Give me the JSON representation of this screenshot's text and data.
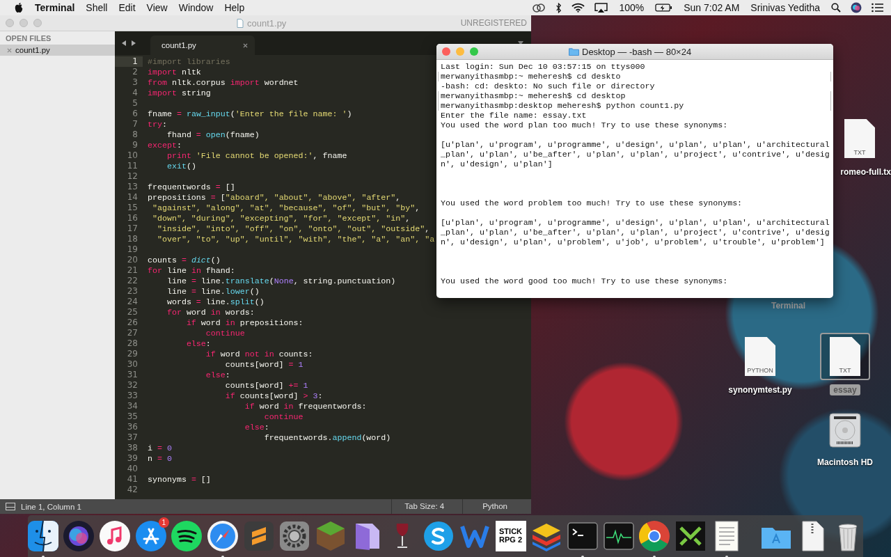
{
  "menu_bar": {
    "app": "Terminal",
    "items": [
      "Shell",
      "Edit",
      "View",
      "Window",
      "Help"
    ],
    "battery": "100%",
    "clock": "Sun 7:02 AM",
    "user": "Srinivas Yeditha"
  },
  "editor": {
    "title": "count1.py",
    "license": "UNREGISTERED",
    "sidebar": {
      "header": "OPEN FILES",
      "files": [
        {
          "name": "count1.py",
          "selected": true
        }
      ]
    },
    "tabs": [
      {
        "label": "count1.py",
        "selected": true
      }
    ],
    "lines": [
      {
        "n": "1",
        "current": true,
        "tokens": [
          {
            "kind": "cm",
            "text": "#import libraries"
          }
        ]
      },
      {
        "n": "2",
        "current": false,
        "tokens": [
          {
            "kind": "kw",
            "text": "import"
          },
          {
            "kind": "p",
            "text": " nltk"
          }
        ]
      },
      {
        "n": "3",
        "current": false,
        "tokens": [
          {
            "kind": "kw",
            "text": "from"
          },
          {
            "kind": "p",
            "text": " nltk.corpus"
          },
          {
            "kind": "kw",
            "text": " import"
          },
          {
            "kind": "p",
            "text": " wordnet"
          }
        ]
      },
      {
        "n": "4",
        "current": false,
        "tokens": [
          {
            "kind": "kw",
            "text": "import"
          },
          {
            "kind": "p",
            "text": " string"
          }
        ]
      },
      {
        "n": "5",
        "current": false
      },
      {
        "n": "6",
        "current": false,
        "tokens": [
          {
            "kind": "p",
            "text": "fname"
          },
          {
            "kind": "kw",
            "text": " ="
          },
          {
            "kind": "fn",
            "text": " raw_input"
          },
          {
            "kind": "p",
            "text": "("
          },
          {
            "kind": "str",
            "text": "'Enter the file name: '"
          },
          {
            "kind": "p",
            "text": ")"
          }
        ]
      },
      {
        "n": "7",
        "current": false,
        "tokens": [
          {
            "kind": "kw",
            "text": "try"
          },
          {
            "kind": "p",
            "text": ":"
          }
        ]
      },
      {
        "n": "8",
        "current": false,
        "tokens": [
          {
            "kind": "p",
            "text": "    fhand"
          },
          {
            "kind": "kw",
            "text": " ="
          },
          {
            "kind": "fn",
            "text": " open"
          },
          {
            "kind": "p",
            "text": "(fname)"
          }
        ]
      },
      {
        "n": "9",
        "current": false,
        "tokens": [
          {
            "kind": "kw",
            "text": "except"
          },
          {
            "kind": "p",
            "text": ":"
          }
        ]
      },
      {
        "n": "10",
        "current": false,
        "tokens": [
          {
            "kind": "kw",
            "text": "    print"
          },
          {
            "kind": "str",
            "text": " 'File cannot be opened:'"
          },
          {
            "kind": "p",
            "text": ", fname"
          }
        ]
      },
      {
        "n": "11",
        "current": false,
        "tokens": [
          {
            "kind": "fn",
            "text": "    exit"
          },
          {
            "kind": "p",
            "text": "()"
          }
        ]
      },
      {
        "n": "12",
        "current": false
      },
      {
        "n": "13",
        "current": false,
        "tokens": [
          {
            "kind": "p",
            "text": "frequentwords"
          },
          {
            "kind": "kw",
            "text": " ="
          },
          {
            "kind": "p",
            "text": " []"
          }
        ]
      },
      {
        "n": "14",
        "current": false,
        "tokens": [
          {
            "kind": "p",
            "text": "prepositions"
          },
          {
            "kind": "kw",
            "text": " ="
          },
          {
            "kind": "p",
            "text": " ["
          },
          {
            "kind": "str",
            "text": "\"aboard\", \"about\", \"above\", \"after\""
          },
          {
            "kind": "p",
            "text": ","
          }
        ]
      },
      {
        "n": "15",
        "current": false,
        "tokens": [
          {
            "kind": "str",
            "text": " \"against\", \"along\", \"at\", \"because\", \"of\", \"but\", \"by\""
          },
          {
            "kind": "p",
            "text": ","
          }
        ]
      },
      {
        "n": "16",
        "current": false,
        "tokens": [
          {
            "kind": "str",
            "text": " \"down\", \"during\", \"excepting\", \"for\", \"except\", \"in\""
          },
          {
            "kind": "p",
            "text": ","
          }
        ]
      },
      {
        "n": "17",
        "current": false,
        "tokens": [
          {
            "kind": "str",
            "text": "  \"inside\", \"into\", \"off\", \"on\", \"onto\", \"out\", \"outside\""
          },
          {
            "kind": "p",
            "text": ","
          }
        ]
      },
      {
        "n": "18",
        "current": false,
        "tokens": [
          {
            "kind": "str",
            "text": "  \"over\", \"to\", \"up\", \"until\", \"with\", \"the\", \"a\", \"an\", \"a"
          }
        ]
      },
      {
        "n": "19",
        "current": false
      },
      {
        "n": "20",
        "current": false,
        "tokens": [
          {
            "kind": "p",
            "text": "counts"
          },
          {
            "kind": "kw",
            "text": " ="
          },
          {
            "kind": "it",
            "text": " dict"
          },
          {
            "kind": "p",
            "text": "()"
          }
        ]
      },
      {
        "n": "21",
        "current": false,
        "tokens": [
          {
            "kind": "kw",
            "text": "for"
          },
          {
            "kind": "p",
            "text": " line"
          },
          {
            "kind": "kw",
            "text": " in"
          },
          {
            "kind": "p",
            "text": " fhand:"
          }
        ]
      },
      {
        "n": "22",
        "current": false,
        "tokens": [
          {
            "kind": "p",
            "text": "    line"
          },
          {
            "kind": "kw",
            "text": " ="
          },
          {
            "kind": "p",
            "text": " line."
          },
          {
            "kind": "fn",
            "text": "translate"
          },
          {
            "kind": "p",
            "text": "("
          },
          {
            "kind": "num",
            "text": "None"
          },
          {
            "kind": "p",
            "text": ", string.punctuation)"
          }
        ]
      },
      {
        "n": "23",
        "current": false,
        "tokens": [
          {
            "kind": "p",
            "text": "    line"
          },
          {
            "kind": "kw",
            "text": " ="
          },
          {
            "kind": "p",
            "text": " line."
          },
          {
            "kind": "fn",
            "text": "lower"
          },
          {
            "kind": "p",
            "text": "()"
          }
        ]
      },
      {
        "n": "24",
        "current": false,
        "tokens": [
          {
            "kind": "p",
            "text": "    words"
          },
          {
            "kind": "kw",
            "text": " ="
          },
          {
            "kind": "p",
            "text": " line."
          },
          {
            "kind": "fn",
            "text": "split"
          },
          {
            "kind": "p",
            "text": "()"
          }
        ]
      },
      {
        "n": "25",
        "current": false,
        "tokens": [
          {
            "kind": "kw",
            "text": "    for"
          },
          {
            "kind": "p",
            "text": " word"
          },
          {
            "kind": "kw",
            "text": " in"
          },
          {
            "kind": "p",
            "text": " words:"
          }
        ]
      },
      {
        "n": "26",
        "current": false,
        "tokens": [
          {
            "kind": "kw",
            "text": "        if"
          },
          {
            "kind": "p",
            "text": " word"
          },
          {
            "kind": "kw",
            "text": " in"
          },
          {
            "kind": "p",
            "text": " prepositions:"
          }
        ]
      },
      {
        "n": "27",
        "current": false,
        "tokens": [
          {
            "kind": "kw",
            "text": "            continue"
          }
        ]
      },
      {
        "n": "28",
        "current": false,
        "tokens": [
          {
            "kind": "kw",
            "text": "        else"
          },
          {
            "kind": "p",
            "text": ":"
          }
        ]
      },
      {
        "n": "29",
        "current": false,
        "tokens": [
          {
            "kind": "kw",
            "text": "            if"
          },
          {
            "kind": "p",
            "text": " word"
          },
          {
            "kind": "kw",
            "text": " not in"
          },
          {
            "kind": "p",
            "text": " counts:"
          }
        ]
      },
      {
        "n": "30",
        "current": false,
        "tokens": [
          {
            "kind": "p",
            "text": "                counts[word]"
          },
          {
            "kind": "kw",
            "text": " ="
          },
          {
            "kind": "num",
            "text": " 1"
          }
        ]
      },
      {
        "n": "31",
        "current": false,
        "tokens": [
          {
            "kind": "kw",
            "text": "            else"
          },
          {
            "kind": "p",
            "text": ":"
          }
        ]
      },
      {
        "n": "32",
        "current": false,
        "tokens": [
          {
            "kind": "p",
            "text": "                counts[word]"
          },
          {
            "kind": "kw",
            "text": " +="
          },
          {
            "kind": "num",
            "text": " 1"
          }
        ]
      },
      {
        "n": "33",
        "current": false,
        "tokens": [
          {
            "kind": "kw",
            "text": "                if"
          },
          {
            "kind": "p",
            "text": " counts[word]"
          },
          {
            "kind": "kw",
            "text": " >"
          },
          {
            "kind": "num",
            "text": " 3"
          },
          {
            "kind": "p",
            "text": ":"
          }
        ]
      },
      {
        "n": "34",
        "current": false,
        "tokens": [
          {
            "kind": "kw",
            "text": "                    if"
          },
          {
            "kind": "p",
            "text": " word"
          },
          {
            "kind": "kw",
            "text": " in"
          },
          {
            "kind": "p",
            "text": " frequentwords:"
          }
        ]
      },
      {
        "n": "35",
        "current": false,
        "tokens": [
          {
            "kind": "kw",
            "text": "                        continue"
          }
        ]
      },
      {
        "n": "36",
        "current": false,
        "tokens": [
          {
            "kind": "kw",
            "text": "                    else"
          },
          {
            "kind": "p",
            "text": ":"
          }
        ]
      },
      {
        "n": "37",
        "current": false,
        "tokens": [
          {
            "kind": "p",
            "text": "                        frequentwords."
          },
          {
            "kind": "fn",
            "text": "append"
          },
          {
            "kind": "p",
            "text": "(word)"
          }
        ]
      },
      {
        "n": "38",
        "current": false,
        "tokens": [
          {
            "kind": "p",
            "text": "i"
          },
          {
            "kind": "kw",
            "text": " ="
          },
          {
            "kind": "num",
            "text": " 0"
          }
        ]
      },
      {
        "n": "39",
        "current": false,
        "tokens": [
          {
            "kind": "p",
            "text": "n"
          },
          {
            "kind": "kw",
            "text": " ="
          },
          {
            "kind": "num",
            "text": " 0"
          }
        ]
      },
      {
        "n": "40",
        "current": false
      },
      {
        "n": "41",
        "current": false,
        "tokens": [
          {
            "kind": "p",
            "text": "synonyms"
          },
          {
            "kind": "kw",
            "text": " ="
          },
          {
            "kind": "p",
            "text": " []"
          }
        ]
      },
      {
        "n": "42",
        "current": false
      }
    ],
    "status": {
      "position": "Line 1, Column 1",
      "tab_size": "Tab Size: 4",
      "syntax": "Python"
    }
  },
  "terminal": {
    "title": "Desktop — -bash — 80×24",
    "lines": [
      {
        "kind": "output",
        "text": "Last login: Sun Dec 10 03:57:15 on ttys000"
      },
      {
        "kind": "prompt",
        "text": "merwanyithasmbp:~ meheresh$ cd deskto"
      },
      {
        "kind": "output",
        "text": "-bash: cd: deskto: No such file or directory"
      },
      {
        "kind": "prompt",
        "text": "merwanyithasmbp:~ meheresh$ cd desktop"
      },
      {
        "kind": "prompt",
        "text": "merwanyithasmbp:desktop meheresh$ python count1.py"
      },
      {
        "kind": "output",
        "text": "Enter the file name: essay.txt"
      },
      {
        "kind": "output",
        "text": "You used the word plan too much! Try to use these synonyms:"
      },
      {
        "kind": "blank"
      },
      {
        "kind": "output",
        "text": "[u'plan', u'program', u'programme', u'design', u'plan', u'plan', u'architectural"
      },
      {
        "kind": "output",
        "text": "_plan', u'plan', u'be_after', u'plan', u'plan', u'project', u'contrive', u'desig"
      },
      {
        "kind": "output",
        "text": "n', u'design', u'plan']"
      },
      {
        "kind": "blank"
      },
      {
        "kind": "blank"
      },
      {
        "kind": "blank"
      },
      {
        "kind": "output",
        "text": "You used the word problem too much! Try to use these synonyms:"
      },
      {
        "kind": "blank"
      },
      {
        "kind": "output",
        "text": "[u'plan', u'program', u'programme', u'design', u'plan', u'plan', u'architectural"
      },
      {
        "kind": "output",
        "text": "_plan', u'plan', u'be_after', u'plan', u'plan', u'project', u'contrive', u'desig"
      },
      {
        "kind": "output",
        "text": "n', u'design', u'plan', u'problem', u'job', u'problem', u'trouble', u'problem']"
      },
      {
        "kind": "blank"
      },
      {
        "kind": "blank"
      },
      {
        "kind": "blank"
      },
      {
        "kind": "output",
        "text": "You used the word good too much! Try to use these synonyms:"
      }
    ]
  },
  "desktop": {
    "covered_label": "Terminal",
    "icons": [
      {
        "kind": "document",
        "badge": "TXT",
        "label": "romeo-full.tx",
        "selected": false
      },
      {
        "kind": "document",
        "badge": "PYTHON",
        "label": "synonymtest.py",
        "selected": false
      },
      {
        "kind": "document",
        "badge": "TXT",
        "label": "essay",
        "selected": true
      },
      {
        "kind": "drive",
        "label": "Macintosh HD",
        "selected": false
      }
    ]
  },
  "dock": {
    "apps": [
      {
        "kind": "finder",
        "running": true
      },
      {
        "kind": "siri",
        "running": false
      },
      {
        "kind": "music",
        "running": false
      },
      {
        "kind": "appstore",
        "running": false,
        "badge": "1"
      },
      {
        "kind": "spotify",
        "running": false
      },
      {
        "kind": "safari",
        "running": true
      },
      {
        "kind": "sublime",
        "running": false
      },
      {
        "kind": "prefs",
        "running": false
      },
      {
        "kind": "block",
        "running": false
      },
      {
        "kind": "filemaker",
        "running": false
      },
      {
        "kind": "wine",
        "running": false
      },
      {
        "kind": "skype",
        "running": false
      },
      {
        "kind": "w",
        "running": false
      },
      {
        "kind": "game",
        "running": false,
        "text": "STICK RPG 2"
      },
      {
        "kind": "layers",
        "running": false
      },
      {
        "kind": "terminal",
        "running": true
      },
      {
        "kind": "activity",
        "running": false
      },
      {
        "kind": "chrome",
        "running": true
      },
      {
        "kind": "xa",
        "running": false
      },
      {
        "kind": "textedit",
        "running": true
      }
    ],
    "stacks": [
      {
        "kind": "appsfolder",
        "running": false
      },
      {
        "kind": "zip",
        "running": false
      },
      {
        "kind": "trash",
        "running": false
      }
    ]
  }
}
